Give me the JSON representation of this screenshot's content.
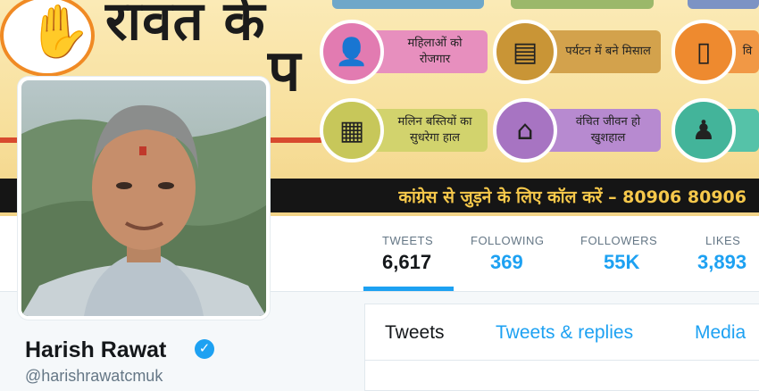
{
  "banner": {
    "headline_top": "रावत के",
    "headline_bottom": "प",
    "helpline": "कांग्रेस से जुड़ने के लिए कॉल करें – 80906 80906",
    "tiles": [
      {
        "icon": "woman-icon",
        "label": "महिलाओं को रोजगार",
        "circle": "#e27bb1",
        "box": "#e78fbe"
      },
      {
        "icon": "bus-icon",
        "label": "पर्यटन में बने मिसाल",
        "circle": "#c99536",
        "box": "#d3a24c"
      },
      {
        "icon": "phone-icon",
        "label": "वि",
        "circle": "#ee8a2f",
        "box": "#f19845"
      },
      {
        "icon": "building-icon",
        "label": "मलिन बस्तियों का सुधरेगा हाल",
        "circle": "#c7c75a",
        "box": "#d2d36d"
      },
      {
        "icon": "house-icon",
        "label": "वंचित जीवन हो खुशहाल",
        "circle": "#a774c2",
        "box": "#b78ad0"
      },
      {
        "icon": "soldier-icon",
        "label": "",
        "circle": "#43b49a",
        "box": "#55c2a8"
      }
    ]
  },
  "profile": {
    "name": "Harish Rawat",
    "handle": "@harishrawatcmuk",
    "verified_symbol": "✓"
  },
  "stats": [
    {
      "label": "TWEETS",
      "value": "6,617"
    },
    {
      "label": "FOLLOWING",
      "value": "369"
    },
    {
      "label": "FOLLOWERS",
      "value": "55K"
    },
    {
      "label": "LIKES",
      "value": "3,893"
    }
  ],
  "tabs": [
    {
      "label": "Tweets"
    },
    {
      "label": "Tweets & replies"
    },
    {
      "label": "Media"
    }
  ],
  "colors": {
    "accent": "#1da1f2",
    "text": "#14171a",
    "muted": "#657786"
  }
}
